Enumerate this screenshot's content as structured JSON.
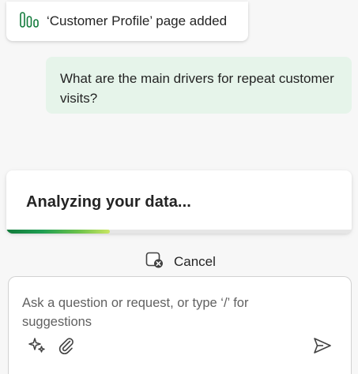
{
  "notice": {
    "icon": "bar-chart-icon",
    "text": "‘Customer Profile’ page added"
  },
  "user_message": {
    "text": "What are the main drivers for repeat customer visits?"
  },
  "status": {
    "text": "Analyzing your data...",
    "progress": 0.3,
    "progress_colors": [
      "#117a3a",
      "#6cc24a",
      "#c9e663"
    ]
  },
  "cancel": {
    "icon": "stop-icon",
    "label": "Cancel"
  },
  "composer": {
    "placeholder": "Ask a question or request, or type ‘/’ for suggestions",
    "tools": [
      "sparkle-icon",
      "attach-icon"
    ],
    "send_icon": "send-icon"
  },
  "colors": {
    "accent": "#117a3a",
    "bubble_bg": "#e6f4ea",
    "background": "#f7f7f7"
  }
}
